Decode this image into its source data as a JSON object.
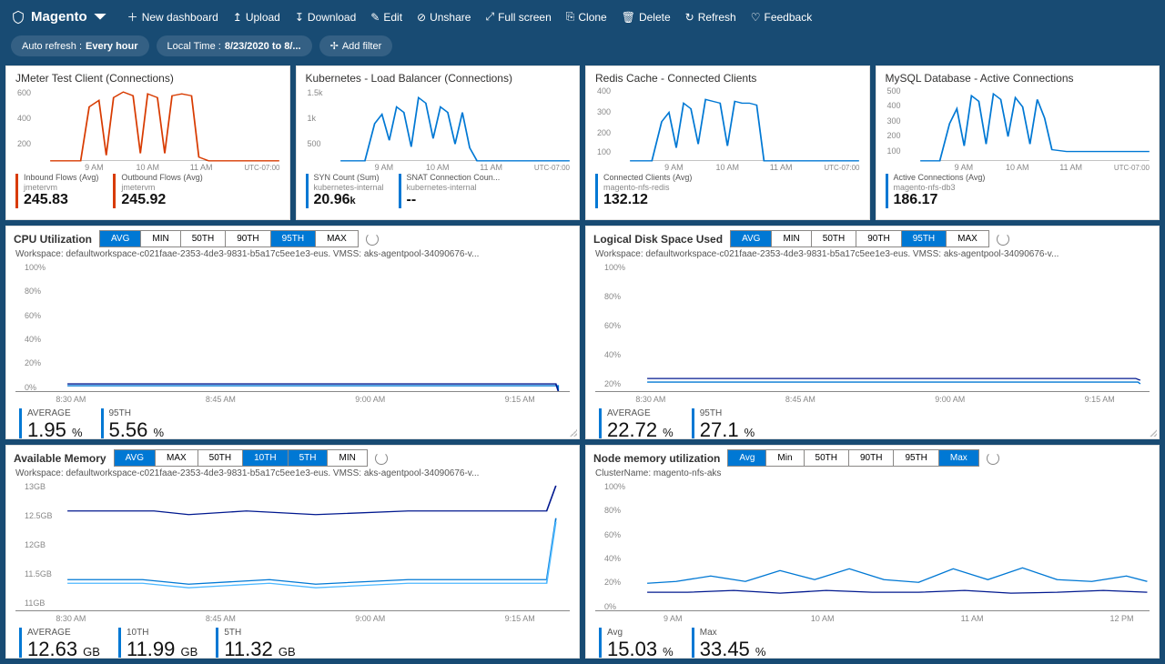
{
  "header": {
    "brand": "Magento",
    "buttons": {
      "newDashboard": "New dashboard",
      "upload": "Upload",
      "download": "Download",
      "edit": "Edit",
      "unshare": "Unshare",
      "fullscreen": "Full screen",
      "clone": "Clone",
      "delete": "Delete",
      "refresh": "Refresh",
      "feedback": "Feedback"
    },
    "pills": {
      "autoRefreshLabel": "Auto refresh :",
      "autoRefreshValue": "Every hour",
      "timeLabel": "Local Time :",
      "timeValue": "8/23/2020 to 8/...",
      "addFilter": "Add filter"
    }
  },
  "smallTiles": {
    "utc": "UTC-07:00",
    "xticks": [
      "9 AM",
      "10 AM",
      "11 AM"
    ],
    "jmeter": {
      "title": "JMeter Test Client (Connections)",
      "yticks": [
        "600",
        "400",
        "200"
      ],
      "m1label": "Inbound Flows (Avg)",
      "m1sub": "jmetervm",
      "m1val": "245.83",
      "m2label": "Outbound Flows (Avg)",
      "m2sub": "jmetervm",
      "m2val": "245.92"
    },
    "k8s": {
      "title": "Kubernetes - Load Balancer (Connections)",
      "yticks": [
        "1.5k",
        "1k",
        "500"
      ],
      "m1label": "SYN Count (Sum)",
      "m1sub": "kubernetes-internal",
      "m1val": "20.96",
      "m1unit": "k",
      "m2label": "SNAT Connection Coun...",
      "m2sub": "kubernetes-internal",
      "m2val": "--"
    },
    "redis": {
      "title": "Redis Cache - Connected Clients",
      "yticks": [
        "400",
        "300",
        "200",
        "100"
      ],
      "m1label": "Connected Clients (Avg)",
      "m1sub": "magento-nfs-redis",
      "m1val": "132.12"
    },
    "mysql": {
      "title": "MySQL Database - Active Connections",
      "yticks": [
        "500",
        "400",
        "300",
        "200",
        "100"
      ],
      "m1label": "Active Connections (Avg)",
      "m1sub": "magento-nfs-db3",
      "m1val": "186.17"
    }
  },
  "wide": {
    "cpu": {
      "title": "CPU Utilization",
      "seg": [
        "AVG",
        "MIN",
        "50TH",
        "90TH",
        "95TH",
        "MAX"
      ],
      "segOn": [
        0,
        4
      ],
      "sub": "Workspace: defaultworkspace-c021faae-2353-4de3-9831-b5a17c5ee1e3-eus. VMSS: aks-agentpool-34090676-v...",
      "yticks": [
        "100%",
        "80%",
        "60%",
        "40%",
        "20%",
        "0%"
      ],
      "xticks": [
        "8:30 AM",
        "8:45 AM",
        "9:00 AM",
        "9:15 AM"
      ],
      "m": [
        {
          "l": "AVERAGE",
          "v": "1.95",
          "u": "%"
        },
        {
          "l": "95TH",
          "v": "5.56",
          "u": "%"
        }
      ]
    },
    "disk": {
      "title": "Logical Disk Space Used",
      "seg": [
        "AVG",
        "MIN",
        "50TH",
        "90TH",
        "95TH",
        "MAX"
      ],
      "segOn": [
        0,
        4
      ],
      "sub": "Workspace: defaultworkspace-c021faae-2353-4de3-9831-b5a17c5ee1e3-eus. VMSS: aks-agentpool-34090676-v...",
      "yticks": [
        "100%",
        "80%",
        "60%",
        "40%",
        "20%"
      ],
      "xticks": [
        "8:30 AM",
        "8:45 AM",
        "9:00 AM",
        "9:15 AM"
      ],
      "m": [
        {
          "l": "AVERAGE",
          "v": "22.72",
          "u": "%"
        },
        {
          "l": "95TH",
          "v": "27.1",
          "u": "%"
        }
      ]
    },
    "mem": {
      "title": "Available Memory",
      "seg": [
        "AVG",
        "MAX",
        "50TH",
        "10TH",
        "5TH",
        "MIN"
      ],
      "segOn": [
        0,
        3,
        4
      ],
      "sub": "Workspace: defaultworkspace-c021faae-2353-4de3-9831-b5a17c5ee1e3-eus. VMSS: aks-agentpool-34090676-v...",
      "yticks": [
        "13GB",
        "12.5GB",
        "12GB",
        "11.5GB",
        "11GB"
      ],
      "xticks": [
        "8:30 AM",
        "8:45 AM",
        "9:00 AM",
        "9:15 AM"
      ],
      "m": [
        {
          "l": "AVERAGE",
          "v": "12.63",
          "u": "GB"
        },
        {
          "l": "10TH",
          "v": "11.99",
          "u": "GB"
        },
        {
          "l": "5TH",
          "v": "11.32",
          "u": "GB"
        }
      ]
    },
    "nodemem": {
      "title": "Node memory utilization",
      "seg": [
        "Avg",
        "Min",
        "50TH",
        "90TH",
        "95TH",
        "Max"
      ],
      "segOn": [
        0,
        5
      ],
      "sub": "ClusterName: magento-nfs-aks",
      "yticks": [
        "100%",
        "80%",
        "60%",
        "40%",
        "20%",
        "0%"
      ],
      "xticks": [
        "9 AM",
        "10 AM",
        "11 AM",
        "12 PM"
      ],
      "m": [
        {
          "l": "Avg",
          "v": "15.03",
          "u": "%"
        },
        {
          "l": "Max",
          "v": "33.45",
          "u": "%"
        }
      ]
    }
  },
  "chart_data": [
    {
      "type": "line",
      "title": "JMeter Test Client (Connections)",
      "ylim": [
        0,
        620
      ],
      "series": [
        {
          "name": "Inbound Flows",
          "color": "#d83b01",
          "values": [
            0,
            0,
            0,
            480,
            520,
            110,
            560,
            600,
            580,
            120,
            590,
            570,
            130,
            560,
            590,
            560,
            80,
            0,
            0,
            0,
            0
          ]
        }
      ]
    },
    {
      "type": "line",
      "title": "Kubernetes - Load Balancer (Connections)",
      "ylim": [
        0,
        1500
      ],
      "series": [
        {
          "name": "SYN Count",
          "color": "#0078d4",
          "values": [
            0,
            0,
            0,
            900,
            1050,
            550,
            1200,
            1100,
            350,
            1350,
            1250,
            500,
            1200,
            1150,
            400,
            1100,
            300,
            0,
            0,
            0,
            0
          ]
        }
      ]
    },
    {
      "type": "line",
      "title": "Redis Cache - Connected Clients",
      "ylim": [
        0,
        400
      ],
      "series": [
        {
          "name": "Connected Clients",
          "color": "#0078d4",
          "values": [
            0,
            0,
            0,
            260,
            310,
            110,
            360,
            330,
            140,
            380,
            370,
            360,
            120,
            370,
            360,
            360,
            350,
            0,
            0,
            0,
            0
          ]
        }
      ]
    },
    {
      "type": "line",
      "title": "MySQL Database - Active Connections",
      "ylim": [
        0,
        500
      ],
      "series": [
        {
          "name": "Active Connections",
          "color": "#0078d4",
          "values": [
            0,
            0,
            0,
            310,
            420,
            160,
            480,
            450,
            170,
            490,
            460,
            200,
            470,
            430,
            180,
            460,
            380,
            110,
            100,
            100,
            100
          ]
        }
      ]
    },
    {
      "type": "line",
      "title": "CPU Utilization",
      "ylim": [
        0,
        100
      ],
      "xticks": [
        "8:30 AM",
        "8:45 AM",
        "9:00 AM",
        "9:15 AM"
      ],
      "series": [
        {
          "name": "AVERAGE",
          "color": "#0078d4",
          "values": [
            2,
            2,
            2,
            2,
            2,
            2,
            2,
            2,
            2,
            1.8
          ]
        },
        {
          "name": "95TH",
          "color": "#00188f",
          "values": [
            5.6,
            5.6,
            5.6,
            5.6,
            5.6,
            5.6,
            5.6,
            5.6,
            5.6,
            0
          ]
        }
      ]
    },
    {
      "type": "line",
      "title": "Logical Disk Space Used",
      "ylim": [
        20,
        100
      ],
      "xticks": [
        "8:30 AM",
        "8:45 AM",
        "9:00 AM",
        "9:15 AM"
      ],
      "series": [
        {
          "name": "AVERAGE",
          "color": "#0078d4",
          "values": [
            22.7,
            22.7,
            22.7,
            22.7,
            22.7,
            22.7,
            22.7,
            22.7,
            22.7,
            22.7
          ]
        },
        {
          "name": "95TH",
          "color": "#00188f",
          "values": [
            27.1,
            27.1,
            27.1,
            27.1,
            27.1,
            27.1,
            27.1,
            27.1,
            27.1,
            27
          ]
        }
      ]
    },
    {
      "type": "line",
      "title": "Available Memory",
      "ylim": [
        11,
        13
      ],
      "xticks": [
        "8:30 AM",
        "8:45 AM",
        "9:00 AM",
        "9:15 AM"
      ],
      "series": [
        {
          "name": "AVERAGE",
          "color": "#00188f",
          "values": [
            12.6,
            12.6,
            12.55,
            12.6,
            12.6,
            12.55,
            12.6,
            12.6,
            12.6,
            12.6,
            12.6,
            13.1
          ]
        },
        {
          "name": "10TH",
          "color": "#0078d4",
          "values": [
            11.55,
            11.55,
            11.5,
            11.55,
            11.5,
            11.55,
            11.55,
            11.55,
            11.55,
            11.55,
            11.55,
            12.7
          ]
        },
        {
          "name": "5TH",
          "color": "#4db8ff",
          "values": [
            11.5,
            11.5,
            11.45,
            11.5,
            11.45,
            11.5,
            11.5,
            11.5,
            11.5,
            11.5,
            11.5,
            12.65
          ]
        }
      ]
    },
    {
      "type": "line",
      "title": "Node memory utilization",
      "ylim": [
        0,
        100
      ],
      "xticks": [
        "9 AM",
        "10 AM",
        "11 AM",
        "12 PM"
      ],
      "series": [
        {
          "name": "Avg",
          "color": "#00188f",
          "values": [
            14,
            14,
            15,
            14,
            15,
            14,
            15,
            15,
            14,
            15,
            15,
            14,
            15,
            15,
            14,
            15
          ]
        },
        {
          "name": "Max",
          "color": "#0078d4",
          "values": [
            21,
            22,
            25,
            22,
            30,
            23,
            32,
            23,
            21,
            32,
            23,
            33,
            23,
            22,
            25,
            22
          ]
        }
      ]
    }
  ]
}
